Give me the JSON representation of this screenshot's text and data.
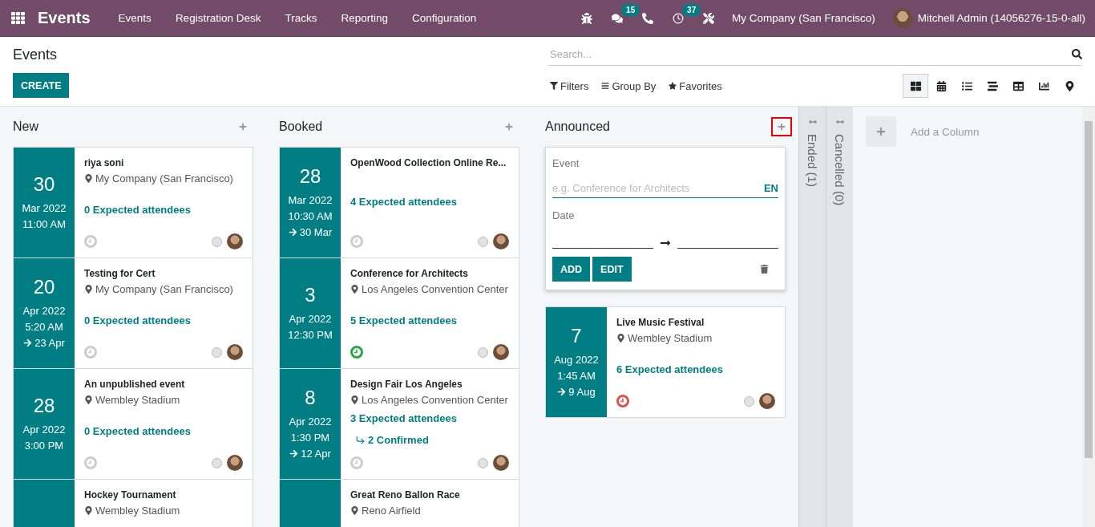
{
  "navbar": {
    "app_title": "Events",
    "menu": [
      "Events",
      "Registration Desk",
      "Tracks",
      "Reporting",
      "Configuration"
    ],
    "systray": [
      {
        "kind": "bug"
      },
      {
        "kind": "chat",
        "badge": "15"
      },
      {
        "kind": "phone"
      },
      {
        "kind": "activity",
        "badge": "37"
      },
      {
        "kind": "tools"
      }
    ],
    "company": "My Company (San Francisco)",
    "user": "Mitchell Admin (14056276-15-0-all)"
  },
  "control_panel": {
    "breadcrumb": "Events",
    "create_button": "CREATE",
    "search": {
      "placeholder": "Search..."
    },
    "filters": [
      {
        "kind": "filter",
        "label": "Filters"
      },
      {
        "kind": "group",
        "label": "Group By"
      },
      {
        "kind": "favorite",
        "label": "Favorites"
      }
    ],
    "views": [
      {
        "kind": "kanban",
        "selected": true
      },
      {
        "kind": "calendar",
        "selected": false
      },
      {
        "kind": "list",
        "selected": false
      },
      {
        "kind": "gantt",
        "selected": false
      },
      {
        "kind": "pivot",
        "selected": false
      },
      {
        "kind": "graph",
        "selected": false
      },
      {
        "kind": "map",
        "selected": false
      }
    ]
  },
  "columns": [
    {
      "title": "New",
      "add_highlighted": false,
      "cards": [
        {
          "day": "30",
          "month": "Mar 2022",
          "time": "11:00 AM",
          "title": "riya soni",
          "location": "My Company (San Francisco)",
          "attendees": "0 Expected attendees",
          "activity": {
            "color": "#cccccc"
          }
        },
        {
          "day": "20",
          "month": "Apr 2022",
          "time": "5:20 AM",
          "end": "23 Apr",
          "title": "Testing for Cert",
          "location": "My Company (San Francisco)",
          "attendees": "0 Expected attendees",
          "activity": {
            "color": "#cccccc"
          }
        },
        {
          "day": "28",
          "month": "Apr 2022",
          "time": "3:00 PM",
          "title": "An unpublished event",
          "location": "Wembley Stadium",
          "attendees": "0 Expected attendees",
          "activity": {
            "color": "#cccccc"
          }
        },
        {
          "title": "Hockey Tournament",
          "location": "Wembley Stadium"
        }
      ]
    },
    {
      "title": "Booked",
      "add_highlighted": false,
      "cards": [
        {
          "day": "28",
          "month": "Mar 2022",
          "time": "10:30 AM",
          "end": "30 Mar",
          "title": "OpenWood Collection Online Re...",
          "attendees": "4 Expected attendees",
          "activity": {
            "color": "#cccccc"
          }
        },
        {
          "day": "3",
          "month": "Apr 2022",
          "time": "12:30 PM",
          "title": "Conference for Architects",
          "location": "Los Angeles Convention Center",
          "attendees": "5 Expected attendees",
          "activity": {
            "color": "#28a745"
          }
        },
        {
          "day": "8",
          "month": "Apr 2022",
          "time": "1:30 PM",
          "end": "12 Apr",
          "title": "Design Fair Los Angeles",
          "location": "Los Angeles Convention Center",
          "attendees": "3 Expected attendees",
          "confirmed": "2 Confirmed",
          "activity": {
            "color": "#cccccc"
          }
        },
        {
          "title": "Great Reno Ballon Race",
          "location": "Reno Airfield"
        }
      ]
    },
    {
      "title": "Announced",
      "add_highlighted": true,
      "quick_create": {
        "event_label": "Event",
        "placeholder": "e.g. Conference for Architects",
        "lang": "EN",
        "date_label": "Date",
        "buttons": [
          "ADD",
          "EDIT"
        ]
      },
      "cards": [
        {
          "day": "7",
          "month": "Aug 2022",
          "time": "1:45 AM",
          "end": "9 Aug",
          "title": "Live Music Festival",
          "location": "Wembley Stadium",
          "attendees": "6 Expected attendees",
          "activity": {
            "color": "#d9534f"
          }
        }
      ]
    }
  ],
  "folded_columns": [
    "Ended (1)",
    "Cancelled (0)"
  ],
  "add_column": "Add a Column"
}
